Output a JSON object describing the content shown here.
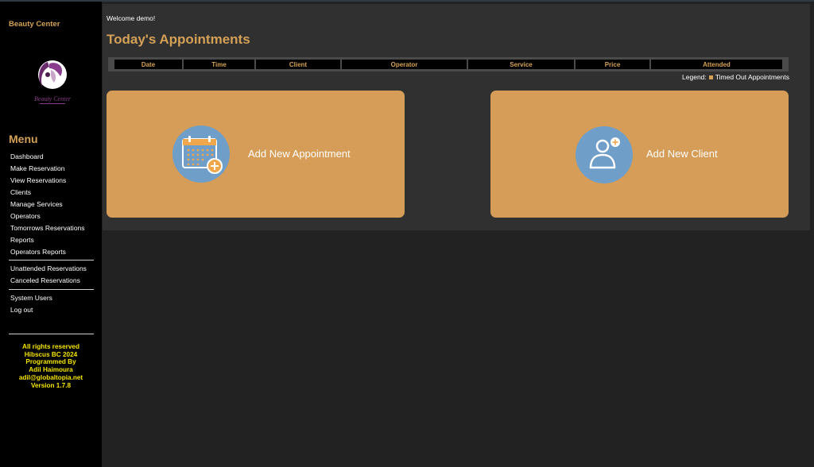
{
  "sidebar": {
    "brand": "Beauty Center",
    "logo_text": "Beauty Center",
    "menu_title": "Menu",
    "items": [
      "Dashboard",
      "Make Reservation",
      "View Reservations",
      "Clients",
      "Manage Services",
      "Operators",
      "Tomorrows Reservations",
      "Reports",
      "Operators Reports",
      "Unattended Reservations",
      "Canceled Reservations",
      "System Users",
      "Log out"
    ],
    "footer": [
      "All rights reserved",
      "Hibscus BC 2024",
      "Programmed By",
      "Adil Haimoura",
      "adil@globaltopia.net",
      "Version 1.7.8"
    ]
  },
  "main": {
    "welcome": "Welcome demo!",
    "title": "Today's Appointments",
    "table_headers": [
      "Date",
      "Time",
      "Client",
      "Operator",
      "Service",
      "Price",
      "Attended"
    ],
    "legend_prefix": "Legend:",
    "legend_label": "Timed Out Appointments",
    "cards": {
      "appointment": "Add New Appointment",
      "client": "Add New Client"
    }
  },
  "colors": {
    "accent": "#d4a056",
    "card": "#d59d57",
    "icon_circle": "#6f9fc9",
    "footer_text": "#f5e500"
  },
  "icons": [
    "calendar-plus-icon",
    "user-plus-icon"
  ]
}
